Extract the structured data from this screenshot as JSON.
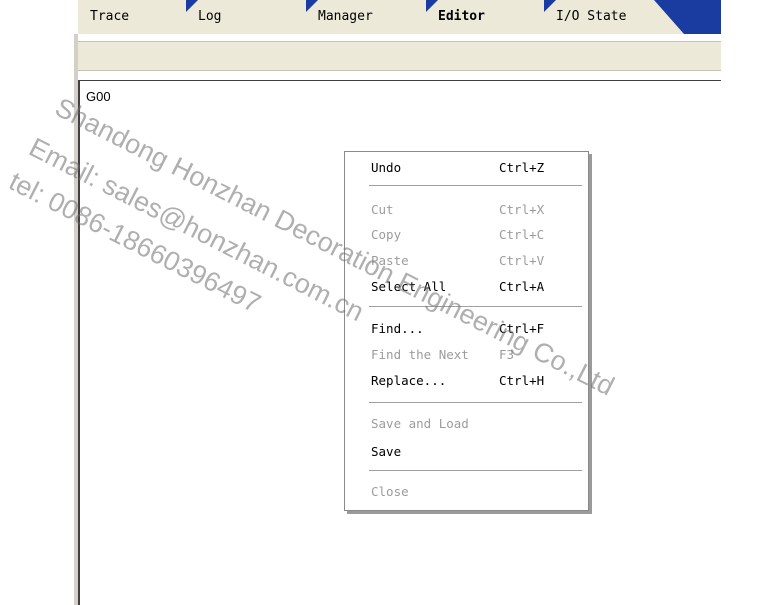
{
  "tabs": [
    {
      "label": "Trace",
      "active": false
    },
    {
      "label": "Log",
      "active": false
    },
    {
      "label": "Manager",
      "active": false
    },
    {
      "label": "Editor",
      "active": true
    },
    {
      "label": "I/O State",
      "active": false
    }
  ],
  "editor": {
    "content": "G00"
  },
  "context_menu": {
    "undo": {
      "label": "Undo",
      "shortcut": "Ctrl+Z",
      "enabled": true
    },
    "cut": {
      "label": "Cut",
      "shortcut": "Ctrl+X",
      "enabled": false
    },
    "copy": {
      "label": "Copy",
      "shortcut": "Ctrl+C",
      "enabled": false
    },
    "paste": {
      "label": "Paste",
      "shortcut": "Ctrl+V",
      "enabled": false
    },
    "select_all": {
      "label": "Select All",
      "shortcut": "Ctrl+A",
      "enabled": true
    },
    "find": {
      "label": "Find...",
      "shortcut": "Ctrl+F",
      "enabled": true
    },
    "find_next": {
      "label": "Find the Next",
      "shortcut": "F3",
      "enabled": false
    },
    "replace": {
      "label": "Replace...",
      "shortcut": "Ctrl+H",
      "enabled": true
    },
    "save_and_load": {
      "label": "Save and Load",
      "shortcut": "",
      "enabled": false
    },
    "save": {
      "label": "Save",
      "shortcut": "",
      "enabled": true
    },
    "close": {
      "label": "Close",
      "shortcut": "",
      "enabled": false
    }
  },
  "watermark": {
    "line1": "Shandong Honzhan Decoration Engineering Co.,Ltd",
    "line2": "Email: sales@honzhan.com.cn",
    "line3": "tel: 0086-18660396497"
  },
  "colors": {
    "tab_accent": "#1a3b9f",
    "menu_disabled": "#9c9c9c",
    "chrome": "#ece9d8"
  }
}
